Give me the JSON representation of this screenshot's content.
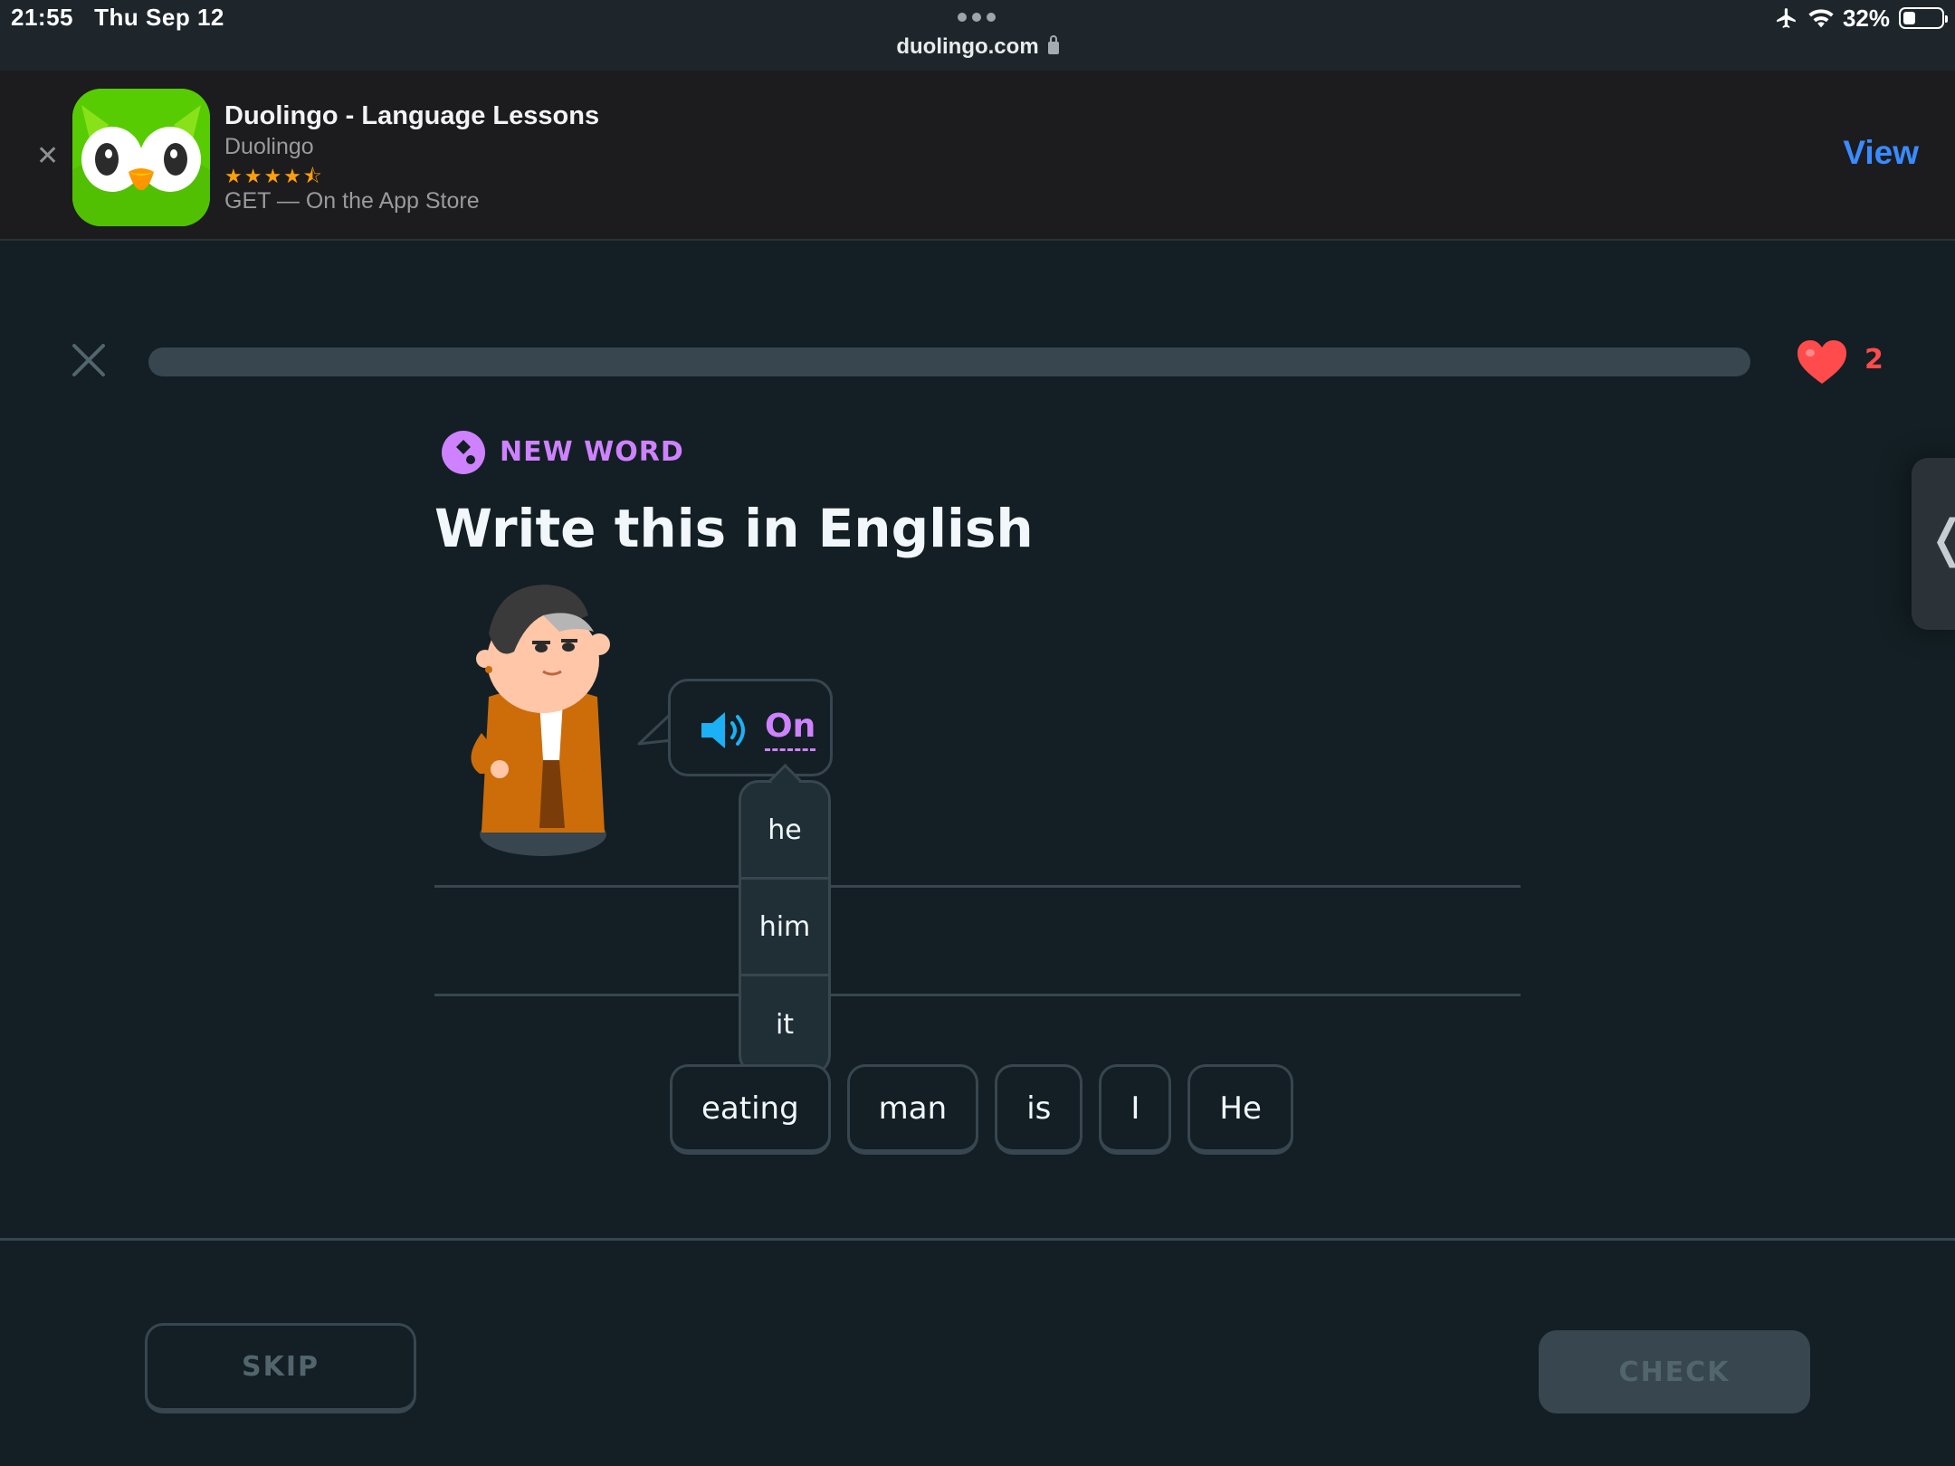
{
  "status_bar": {
    "time": "21:55",
    "date": "Thu Sep 12",
    "url": "duolingo.com",
    "battery_text": "32%",
    "battery_level": 0.32,
    "icons": [
      "airplane-icon",
      "wifi-icon",
      "battery-icon",
      "lock-icon"
    ]
  },
  "app_banner": {
    "name": "Duolingo - Language Lessons",
    "developer": "Duolingo",
    "rating_stars": "★★★★⯪",
    "rating": 4.5,
    "get_text": "GET — On the App Store",
    "view_label": "View"
  },
  "lesson": {
    "progress": 0,
    "hearts": "2"
  },
  "challenge": {
    "badge": "NEW WORD",
    "title": "Write this in English",
    "prompt_word": "On",
    "hints": [
      "he",
      "him",
      "it"
    ],
    "word_bank": [
      "eating",
      "man",
      "is",
      "I",
      "He"
    ]
  },
  "footer": {
    "skip_label": "SKIP",
    "check_label": "CHECK"
  },
  "colors": {
    "background": "#131f24",
    "border": "#37464f",
    "accent_purple": "#ce82ff",
    "heart_red": "#ff4b4b",
    "speaker_blue": "#1cb0f6",
    "ios_link_blue": "#3a8bff",
    "duo_green": "#58cc02"
  }
}
